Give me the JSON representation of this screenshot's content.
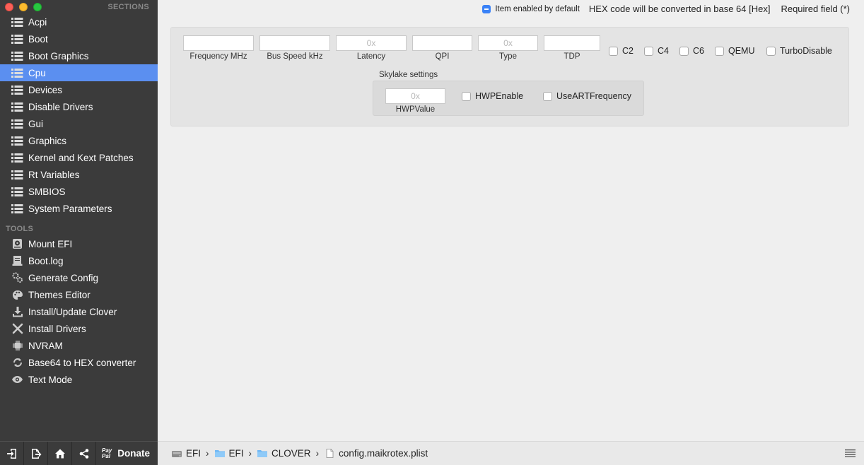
{
  "sidebar": {
    "sections_header": "SECTIONS",
    "tools_header": "TOOLS",
    "sections": [
      {
        "label": "Acpi",
        "icon": "list-icon"
      },
      {
        "label": "Boot",
        "icon": "list-icon"
      },
      {
        "label": "Boot Graphics",
        "icon": "list-icon"
      },
      {
        "label": "Cpu",
        "icon": "list-icon",
        "selected": true
      },
      {
        "label": "Devices",
        "icon": "list-icon"
      },
      {
        "label": "Disable Drivers",
        "icon": "list-icon"
      },
      {
        "label": "Gui",
        "icon": "list-icon"
      },
      {
        "label": "Graphics",
        "icon": "list-icon"
      },
      {
        "label": "Kernel and Kext Patches",
        "icon": "list-icon"
      },
      {
        "label": "Rt Variables",
        "icon": "list-icon"
      },
      {
        "label": "SMBIOS",
        "icon": "list-icon"
      },
      {
        "label": "System Parameters",
        "icon": "list-icon"
      }
    ],
    "tools": [
      {
        "label": "Mount EFI",
        "icon": "disk-icon"
      },
      {
        "label": "Boot.log",
        "icon": "log-icon"
      },
      {
        "label": "Generate Config",
        "icon": "gears-icon"
      },
      {
        "label": "Themes Editor",
        "icon": "palette-icon"
      },
      {
        "label": "Install/Update Clover",
        "icon": "download-icon"
      },
      {
        "label": "Install Drivers",
        "icon": "tools-icon"
      },
      {
        "label": "NVRAM",
        "icon": "chip-icon"
      },
      {
        "label": "Base64 to HEX converter",
        "icon": "convert-icon"
      },
      {
        "label": "Text Mode",
        "icon": "eye-icon"
      }
    ],
    "toolbar": {
      "paypal_line1": "Pay",
      "paypal_line2": "Pal",
      "donate_label": "Donate"
    }
  },
  "legend": {
    "item_enabled": "Item enabled by default",
    "hex_note": "HEX code will be converted in base 64 [Hex]",
    "required": "Required field (*)"
  },
  "cpu": {
    "fields": {
      "frequency": {
        "label": "Frequency MHz",
        "value": "",
        "placeholder": ""
      },
      "bus_speed": {
        "label": "Bus Speed kHz",
        "value": "",
        "placeholder": ""
      },
      "latency": {
        "label": "Latency",
        "value": "",
        "placeholder": "0x"
      },
      "qpi": {
        "label": "QPI",
        "value": "",
        "placeholder": ""
      },
      "type": {
        "label": "Type",
        "value": "",
        "placeholder": "0x"
      },
      "tdp": {
        "label": "TDP",
        "value": "",
        "placeholder": ""
      }
    },
    "checkboxes": {
      "c2": "C2",
      "c4": "C4",
      "c6": "C6",
      "qemu": "QEMU",
      "turbo_disable": "TurboDisable"
    },
    "skylake": {
      "title": "Skylake settings",
      "hwp_value": {
        "label": "HWPValue",
        "value": "",
        "placeholder": "0x"
      },
      "hwp_enable": "HWPEnable",
      "use_art_frequency": "UseARTFrequency"
    }
  },
  "pathbar": {
    "crumbs": [
      "EFI",
      "EFI",
      "CLOVER",
      "config.maikrotex.plist"
    ],
    "separator": "›"
  },
  "colors": {
    "sidebar_bg": "#3b3b3b",
    "selection": "#5b8ff0",
    "accent_check": "#3a82f7"
  }
}
